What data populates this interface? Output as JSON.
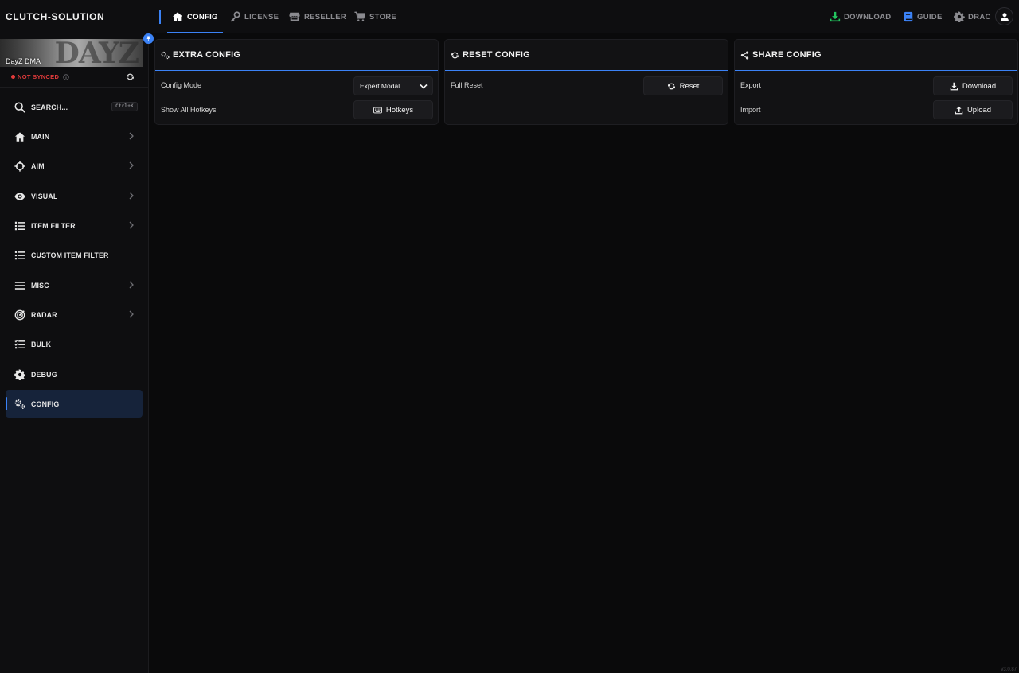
{
  "brand": "CLUTCH-SOLUTION",
  "nav": {
    "tabs": [
      {
        "label": "CONFIG",
        "icon": "home-icon"
      },
      {
        "label": "LICENSE",
        "icon": "key-icon"
      },
      {
        "label": "RESELLER",
        "icon": "store-icon"
      },
      {
        "label": "STORE",
        "icon": "cart-icon"
      }
    ],
    "active_tab": "CONFIG",
    "right": {
      "download": "DOWNLOAD",
      "guide": "GUIDE",
      "user": "DRAC"
    }
  },
  "sidebar": {
    "game_title": "DayZ DMA",
    "banner_art": "DAYZ",
    "sync_status": "NOT SYNCED",
    "search_label": "SEARCH...",
    "search_shortcut": "Ctrl+K",
    "items": [
      {
        "label": "MAIN",
        "icon": "home-icon",
        "chevron": true
      },
      {
        "label": "AIM",
        "icon": "crosshair-icon",
        "chevron": true
      },
      {
        "label": "VISUAL",
        "icon": "eye-icon",
        "chevron": true
      },
      {
        "label": "ITEM FILTER",
        "icon": "list-icon",
        "chevron": true
      },
      {
        "label": "CUSTOM ITEM FILTER",
        "icon": "list-icon",
        "chevron": false
      },
      {
        "label": "MISC",
        "icon": "menu-icon",
        "chevron": true
      },
      {
        "label": "RADAR",
        "icon": "radar-icon",
        "chevron": true
      },
      {
        "label": "BULK",
        "icon": "checklist-icon",
        "chevron": false
      },
      {
        "label": "DEBUG",
        "icon": "gear-icon",
        "chevron": false
      },
      {
        "label": "CONFIG",
        "icon": "gears-icon",
        "chevron": false,
        "active": true
      }
    ]
  },
  "cards": {
    "extra": {
      "title": "EXTRA CONFIG",
      "config_mode_label": "Config Mode",
      "config_mode_value": "Expert Modal",
      "hotkeys_label": "Show All Hotkeys",
      "hotkeys_button": "Hotkeys"
    },
    "reset": {
      "title": "RESET CONFIG",
      "full_reset_label": "Full Reset",
      "reset_button": "Reset"
    },
    "share": {
      "title": "SHARE CONFIG",
      "export_label": "Export",
      "download_button": "Download",
      "import_label": "Import",
      "upload_button": "Upload"
    }
  },
  "version": "v3.0.87",
  "colors": {
    "accent": "#3b82f6",
    "download_icon": "#22c55e",
    "error": "#e23b3b"
  }
}
